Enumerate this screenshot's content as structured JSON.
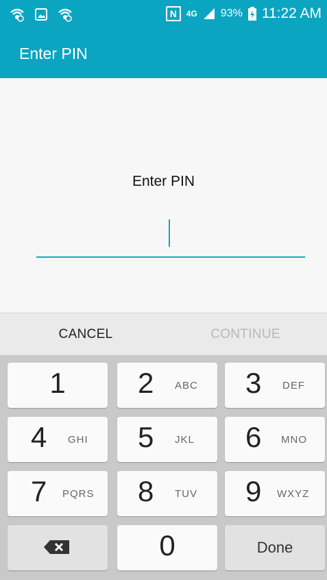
{
  "status_bar": {
    "network": "4G",
    "battery_percent": "93%",
    "time": "11:22 AM",
    "nfc_label": "N"
  },
  "app_bar": {
    "title": "Enter PIN"
  },
  "content": {
    "prompt": "Enter PIN",
    "pin_value": ""
  },
  "actions": {
    "cancel": "CANCEL",
    "continue": "CONTINUE"
  },
  "keypad": {
    "keys": [
      {
        "digit": "1",
        "letters": ""
      },
      {
        "digit": "2",
        "letters": "ABC"
      },
      {
        "digit": "3",
        "letters": "DEF"
      },
      {
        "digit": "4",
        "letters": "GHI"
      },
      {
        "digit": "5",
        "letters": "JKL"
      },
      {
        "digit": "6",
        "letters": "MNO"
      },
      {
        "digit": "7",
        "letters": "PQRS"
      },
      {
        "digit": "8",
        "letters": "TUV"
      },
      {
        "digit": "9",
        "letters": "WXYZ"
      },
      {
        "digit": "0",
        "letters": ""
      }
    ],
    "done_label": "Done"
  },
  "colors": {
    "accent": "#0ba5c2",
    "keypad_bg": "#c9c9c9",
    "disabled_text": "#b8b8b8"
  }
}
